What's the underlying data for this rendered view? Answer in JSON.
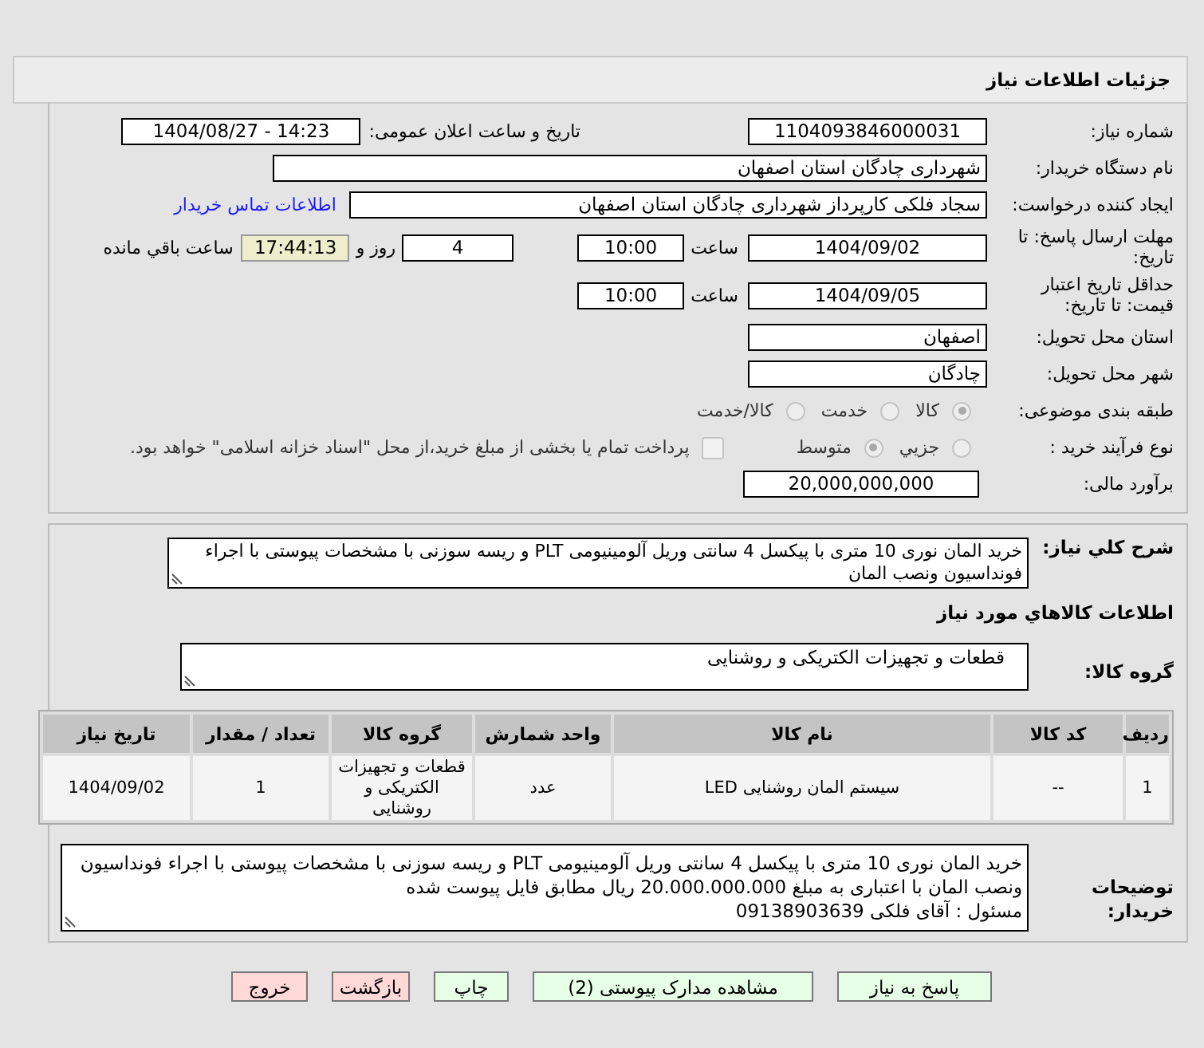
{
  "title": "جزئیات اطلاعات نیاز",
  "need_number": {
    "label": "شماره نیاز:",
    "value": "1104093846000031"
  },
  "announce": {
    "label": "تاریخ و ساعت اعلان عمومی:",
    "value": "1404/08/27 - 14:23"
  },
  "buyer_org": {
    "label": "نام دستگاه خریدار:",
    "value": "شهرداری چادگان استان اصفهان"
  },
  "requester": {
    "label": "ایجاد کننده درخواست:",
    "value": "سجاد فلکی کارپرداز شهرداری چادگان استان اصفهان",
    "link": "اطلاعات تماس خریدار"
  },
  "reply_deadline": {
    "label": "مهلت ارسال پاسخ: تا تاریخ:",
    "date": "1404/09/02",
    "time_label": "ساعت",
    "time": "10:00",
    "days": "4",
    "days_label": "روز و",
    "remaining": "17:44:13",
    "remaining_label": "ساعت باقي مانده"
  },
  "price_validity": {
    "label": "حداقل تاریخ اعتبار قیمت: تا تاریخ:",
    "date": "1404/09/05",
    "time_label": "ساعت",
    "time": "10:00"
  },
  "province": {
    "label": "استان محل تحویل:",
    "value": "اصفهان"
  },
  "city": {
    "label": "شهر محل تحویل:",
    "value": "چادگان"
  },
  "category": {
    "label": "طبقه بندی موضوعی:",
    "options": [
      {
        "label": "کالا",
        "selected": true
      },
      {
        "label": "خدمت",
        "selected": false
      },
      {
        "label": "کالا/خدمت",
        "selected": false
      }
    ]
  },
  "process": {
    "label": "نوع فرآیند خرید :",
    "options": [
      {
        "label": "جزیي",
        "selected": false
      },
      {
        "label": "متوسط",
        "selected": true
      }
    ],
    "payment": {
      "label": "پرداخت تمام یا بخشی از مبلغ خرید،از محل \"اسناد خزانه اسلامی\" خواهد بود.",
      "checked": false
    }
  },
  "budget": {
    "label": "برآورد مالی:",
    "value": "20,000,000,000"
  },
  "description": {
    "label": "شرح کلي نياز:",
    "value": "خرید المان نوری 10 متری با پیکسل 4 سانتی وریل آلومینیومی PLT و ریسه سوزنی با مشخصات پیوستی با اجراء فونداسیون ونصب المان"
  },
  "goods_heading": "اطلاعات کالاهاي مورد نياز",
  "goods_group": {
    "label": "گروه کالا:",
    "value": "قطعات و تجهیزات الکتریکی و روشنایی"
  },
  "table": {
    "columns": [
      "رديف",
      "کد کالا",
      "نام کالا",
      "واحد شمارش",
      "گروه کالا",
      "تعداد / مقدار",
      "تاریخ نیاز"
    ],
    "rows": [
      [
        "1",
        "--",
        "سیستم المان روشنایی LED",
        "عدد",
        "قطعات و تجهیزات الکتریکی و روشنایی",
        "1",
        "1404/09/02"
      ]
    ]
  },
  "buyer_notes": {
    "label": "توضیحات خریدار:",
    "lines": [
      "خرید المان نوری 10 متری با پیکسل 4 سانتی وریل آلومینیومی PLT و ریسه سوزنی با مشخصات پیوستی با اجراء فونداسیون ونصب المان با اعتباری به مبلغ 20.000.000.000 ریال مطابق فایل پیوست شده",
      "مسئول : آقای فلکی 09138903639"
    ]
  },
  "buttons": [
    {
      "label": "پاسخ به نیاز",
      "kind": "normal"
    },
    {
      "label": "مشاهده مدارک پیوستی (2)",
      "kind": "normal"
    },
    {
      "label": "چاپ",
      "kind": "normal"
    },
    {
      "label": "بازگشت",
      "kind": "danger"
    },
    {
      "label": "خروج",
      "kind": "danger"
    }
  ]
}
